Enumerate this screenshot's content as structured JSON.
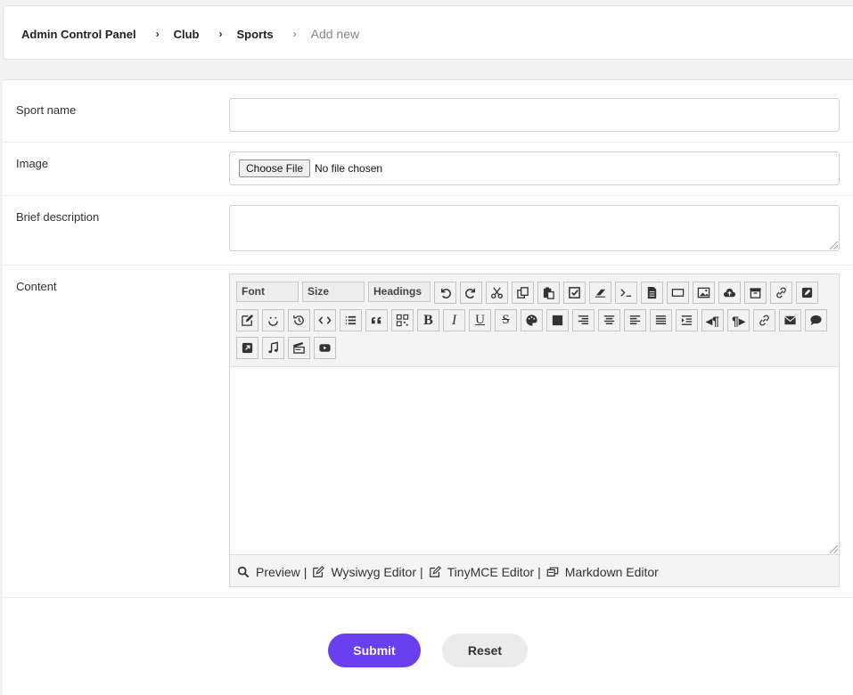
{
  "breadcrumb": {
    "items": [
      "Admin Control Panel",
      "Club",
      "Sports"
    ],
    "current": "Add new"
  },
  "form": {
    "sport_name": {
      "label": "Sport name",
      "value": "",
      "placeholder": ""
    },
    "image": {
      "label": "Image",
      "button_label": "Choose File",
      "status": "No file chosen"
    },
    "brief_description": {
      "label": "Brief description",
      "value": ""
    },
    "content": {
      "label": "Content",
      "selects": [
        "Font",
        "Size",
        "Headings"
      ],
      "toolbar_icons_row1": [
        "undo-icon",
        "redo-icon",
        "cut-icon",
        "copy-icon",
        "paste-icon",
        "select-all-icon",
        "eraser-icon",
        "terminal-icon",
        "document-icon",
        "rectangle-icon",
        "image-icon",
        "cloud-upload-icon",
        "archive-icon",
        "link-icon",
        "edit-square-icon"
      ],
      "toolbar_icons_row2": [
        "edit-icon",
        "smiley-icon",
        "history-icon",
        "code-icon",
        "list-icon",
        "quote-icon",
        "qrcode-icon",
        "bold-icon",
        "italic-icon",
        "underline-icon",
        "strikethrough-icon",
        "palette-icon",
        "square-icon",
        "align-right-icon",
        "align-center-icon",
        "align-left-icon",
        "align-justify-icon",
        "indent-icon",
        "ltr-icon",
        "rtl-icon",
        "unlink-icon",
        "envelope-icon",
        "comment-icon"
      ],
      "toolbar_icons_row3": [
        "external-link-icon",
        "music-icon",
        "clapperboard-icon",
        "youtube-icon"
      ],
      "footer": {
        "preview": "Preview",
        "wysiwyg": "Wysiwyg Editor",
        "tinymce": "TinyMCE Editor",
        "markdown": "Markdown Editor",
        "separator": "|"
      }
    }
  },
  "actions": {
    "submit": "Submit",
    "reset": "Reset"
  },
  "colors": {
    "accent": "#6a3ff0",
    "reset_bg": "#ebebeb"
  }
}
